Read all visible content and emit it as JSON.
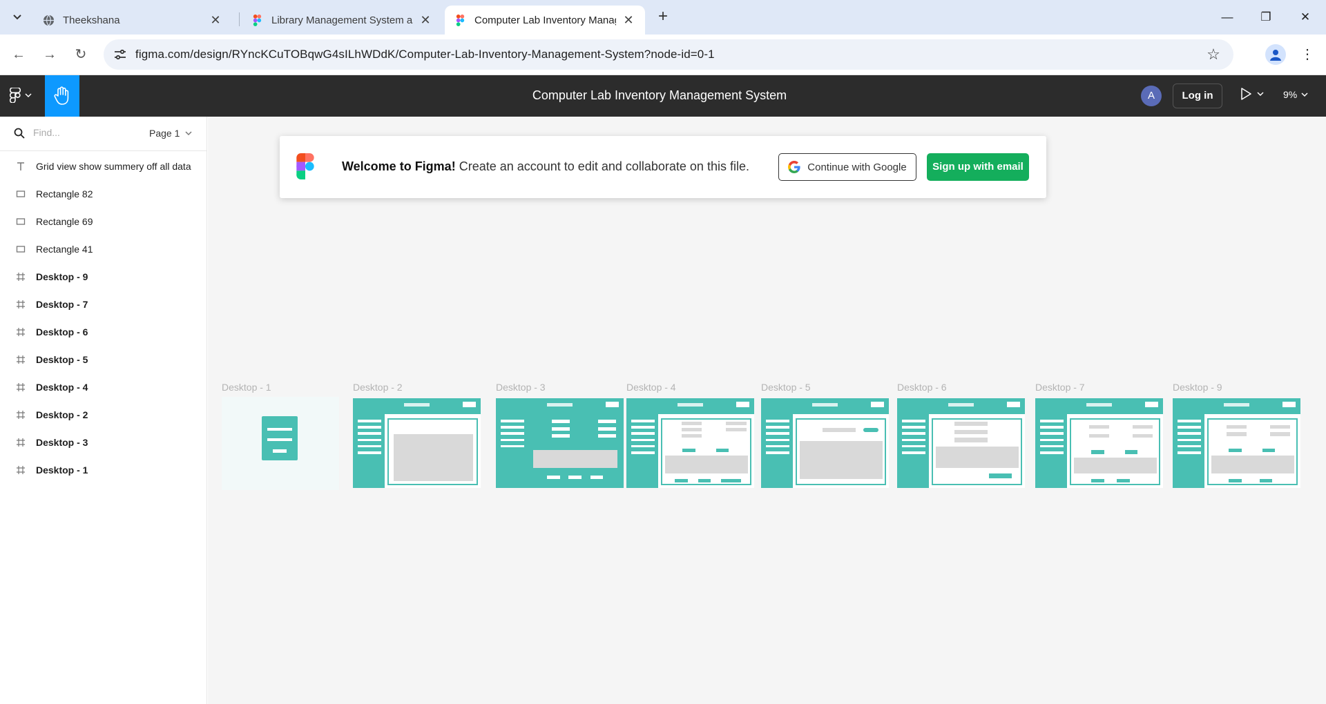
{
  "browser": {
    "tabs": [
      {
        "title": "Theekshana",
        "active": false,
        "icon": "globe-icon"
      },
      {
        "title": "Library Management System as",
        "active": false,
        "icon": "figma-icon"
      },
      {
        "title": "Computer Lab Inventory Manag",
        "active": true,
        "icon": "figma-icon"
      }
    ],
    "url": "figma.com/design/RYncKCuTOBqwG4sILhWDdK/Computer-Lab-Inventory-Management-System?node-id=0-1"
  },
  "figma": {
    "file_title": "Computer Lab Inventory Management System",
    "avatar_initial": "A",
    "login_label": "Log in",
    "zoom": "9%"
  },
  "layers_panel": {
    "find_placeholder": "Find...",
    "page_label": "Page 1",
    "items": [
      {
        "name": "Grid view show summery off all data",
        "type": "text"
      },
      {
        "name": "Rectangle 82",
        "type": "rectangle"
      },
      {
        "name": "Rectangle 69",
        "type": "rectangle"
      },
      {
        "name": "Rectangle 41",
        "type": "rectangle"
      },
      {
        "name": "Desktop - 9",
        "type": "frame"
      },
      {
        "name": "Desktop - 7",
        "type": "frame"
      },
      {
        "name": "Desktop - 6",
        "type": "frame"
      },
      {
        "name": "Desktop - 5",
        "type": "frame"
      },
      {
        "name": "Desktop - 4",
        "type": "frame"
      },
      {
        "name": "Desktop - 2",
        "type": "frame"
      },
      {
        "name": "Desktop - 3",
        "type": "frame"
      },
      {
        "name": "Desktop - 1",
        "type": "frame"
      }
    ]
  },
  "welcome_banner": {
    "heading": "Welcome to Figma!",
    "message": " Create an account to edit and collaborate on this file.",
    "google_label": "Continue with Google",
    "email_label": "Sign up with email"
  },
  "canvas_frames": [
    {
      "label": "Desktop - 1"
    },
    {
      "label": "Desktop - 2"
    },
    {
      "label": "Desktop - 3"
    },
    {
      "label": "Desktop - 4"
    },
    {
      "label": "Desktop - 5"
    },
    {
      "label": "Desktop - 6"
    },
    {
      "label": "Desktop - 7"
    },
    {
      "label": "Desktop - 9"
    }
  ],
  "colors": {
    "frame_accent": "#49bfb3",
    "figma_blue": "#0d99ff",
    "signup_green": "#14ae5c",
    "toolbar_dark": "#2c2c2c"
  }
}
